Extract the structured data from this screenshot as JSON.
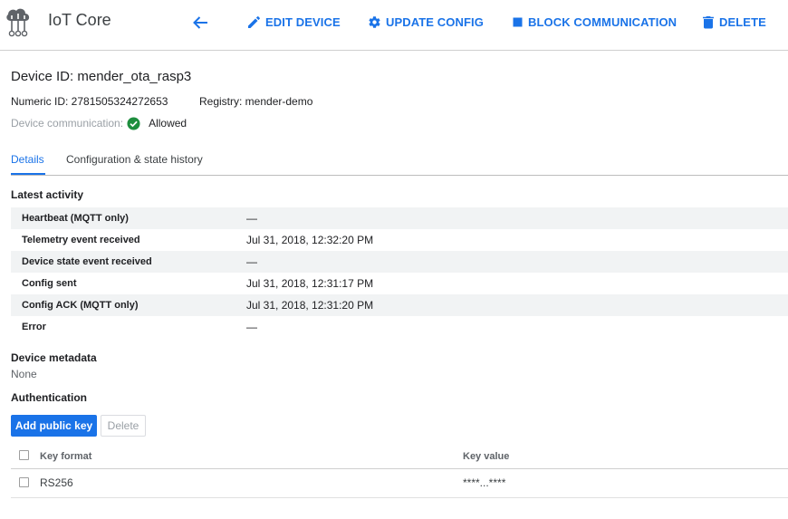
{
  "header": {
    "product_name": "IoT Core",
    "back_icon": "arrow-back-icon",
    "actions": {
      "edit": "EDIT DEVICE",
      "update": "UPDATE CONFIG",
      "block": "BLOCK COMMUNICATION",
      "delete": "DELETE"
    },
    "accent_color": "#1a73e8"
  },
  "device": {
    "title": "Device ID: mender_ota_rasp3",
    "numeric_id": "Numeric ID: 2781505324272653",
    "registry": "Registry: mender-demo",
    "communication_label": "Device communication:",
    "communication_value": "Allowed",
    "communication_status_color": "#1e8e3e"
  },
  "tabs": {
    "details": "Details",
    "config_history": "Configuration & state history"
  },
  "latest_activity": {
    "title": "Latest activity",
    "rows": [
      {
        "label": "Heartbeat (MQTT only)",
        "value": "—"
      },
      {
        "label": "Telemetry event received",
        "value": "Jul 31, 2018, 12:32:20 PM"
      },
      {
        "label": "Device state event received",
        "value": "—"
      },
      {
        "label": "Config sent",
        "value": "Jul 31, 2018, 12:31:17 PM"
      },
      {
        "label": "Config ACK (MQTT only)",
        "value": "Jul 31, 2018, 12:31:20 PM"
      },
      {
        "label": "Error",
        "value": "—"
      }
    ]
  },
  "metadata": {
    "title": "Device metadata",
    "value": "None"
  },
  "authentication": {
    "title": "Authentication",
    "add_button": "Add public key",
    "delete_button": "Delete",
    "columns": {
      "format": "Key format",
      "value": "Key value"
    },
    "keys": [
      {
        "format": "RS256",
        "value": "****...****"
      }
    ]
  }
}
